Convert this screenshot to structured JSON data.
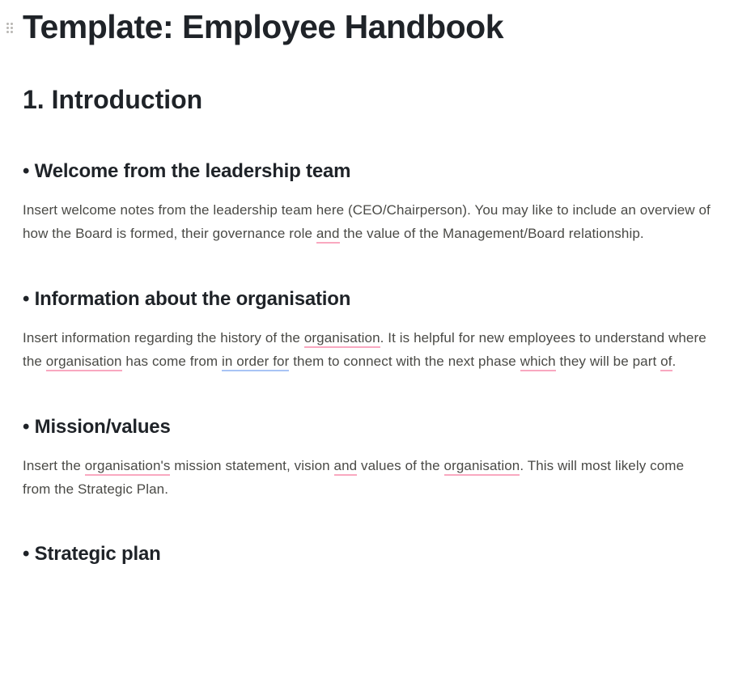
{
  "title": "Template: Employee Handbook",
  "sections": {
    "intro": {
      "number": "1.",
      "heading": "Introduction",
      "items": {
        "welcome": {
          "heading": "Welcome from the leadership team",
          "body": {
            "t1": "Insert welcome notes from the leadership team here (CEO/Chairperson). You may like to include an overview of how the Board is formed, their governance role ",
            "u1": "and",
            "t2": " the value of the Management/Board relationship."
          }
        },
        "about": {
          "heading": "Information about the organisation",
          "body": {
            "t1": "Insert information regarding the history of the ",
            "u1": "organisation",
            "t2": ". It is helpful for new employees to understand where the ",
            "u2": "organisation",
            "t3": " has come from ",
            "u3": "in order for",
            "t4": " them to connect with the next phase ",
            "u4": "which",
            "t5": " they will be part ",
            "u5": "of",
            "t6": "."
          }
        },
        "mission": {
          "heading": "Mission/values",
          "body": {
            "t1": "Insert the ",
            "u1": "organisation's",
            "t2": " mission statement, vision ",
            "u2": "and",
            "t3": " values of the ",
            "u3": "organisation",
            "t4": ". This will most likely come from the Strategic Plan."
          }
        },
        "strategic": {
          "heading": "Strategic plan"
        }
      }
    }
  },
  "bullet": "•"
}
